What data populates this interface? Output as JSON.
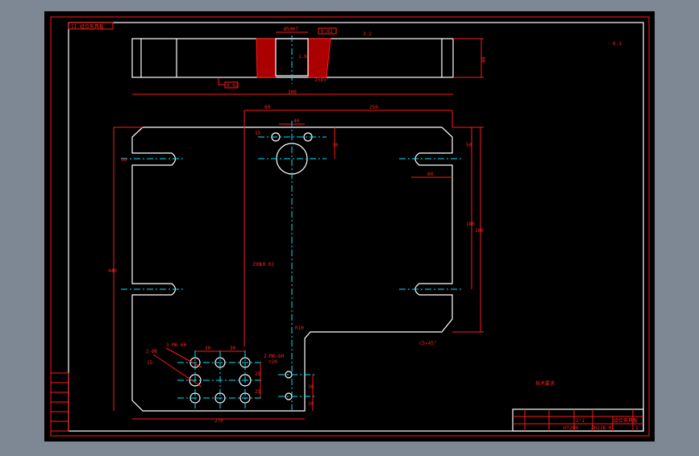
{
  "colors": {
    "background": "#7d8894",
    "canvas": "#000000",
    "outline": "#ffffff",
    "dimension": "#ff1a1a",
    "centerline": "#00e5ff"
  },
  "title_note": "II-组合夹具板",
  "section_view": {
    "bore_label": "Ø50H7",
    "flatness_label": "0.02",
    "parallel_label": "0.02",
    "roughness_top": "3.2",
    "roughness_bore": "1.6",
    "chamfer": "2×45°",
    "thickness": "40",
    "width_label": "300"
  },
  "plan_view": {
    "dim_top_offset": "80",
    "dim_top_total": "250",
    "dim_bore_spacing": "40",
    "dim_15": "15",
    "dim_30": "30",
    "dim_left_slot": "16",
    "dim_right_slot": "60",
    "dim_right_top": "50",
    "dim_right_mid": "180",
    "dim_right_total": "260",
    "dim_left_total": "440",
    "dim_bore_center": "290",
    "bore_tol": "±0.02",
    "hole_3": "3-M6-6H",
    "hole_2a": "2-Ø6",
    "hole_2a_depth": "15",
    "hole_2b": "2-M6-6H",
    "hole_2b_depth": "▽20",
    "dim_pitch_1": "30",
    "dim_pitch_2": "30",
    "dim_v1": "25",
    "dim_v2": "25",
    "dim_small_1": "30",
    "dim_small_2": "30",
    "dim_bottom": "270",
    "radius_label": "R10",
    "chamfer_label": "C5×45°",
    "tech_note": "技术要求"
  },
  "roughness_corner": "6.3",
  "title_block": {
    "part_name": "组合夹具板",
    "drawing_no": "ZHJJB-01",
    "material": "HT200",
    "scale": "1:1",
    "sheet": "1"
  }
}
